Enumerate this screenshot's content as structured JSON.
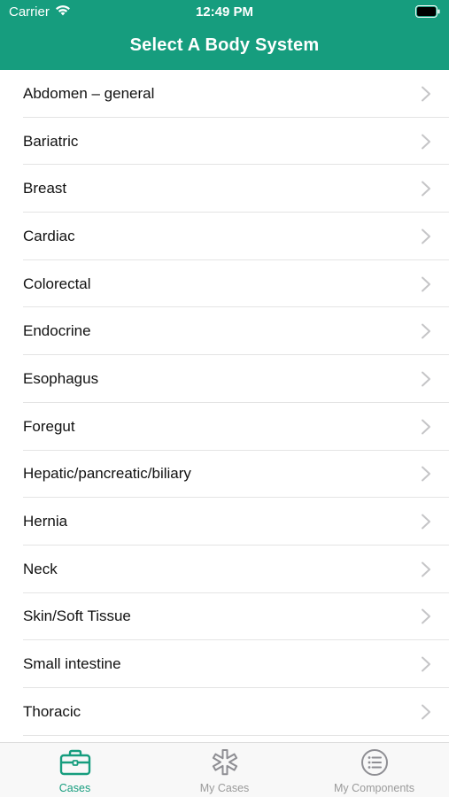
{
  "status_bar": {
    "carrier": "Carrier",
    "time": "12:49 PM"
  },
  "header": {
    "title": "Select A Body System",
    "color": "#169d7e"
  },
  "list": {
    "items": [
      {
        "label": "Abdomen – general"
      },
      {
        "label": "Bariatric"
      },
      {
        "label": "Breast"
      },
      {
        "label": "Cardiac"
      },
      {
        "label": "Colorectal"
      },
      {
        "label": "Endocrine"
      },
      {
        "label": "Esophagus"
      },
      {
        "label": "Foregut"
      },
      {
        "label": "Hepatic/pancreatic/biliary"
      },
      {
        "label": "Hernia"
      },
      {
        "label": "Neck"
      },
      {
        "label": "Skin/Soft Tissue"
      },
      {
        "label": "Small intestine"
      },
      {
        "label": "Thoracic"
      }
    ]
  },
  "tabbar": {
    "tabs": [
      {
        "label": "Cases",
        "icon": "briefcase-icon",
        "active": true
      },
      {
        "label": "My Cases",
        "icon": "asterisk-icon",
        "active": false
      },
      {
        "label": "My Components",
        "icon": "list-icon",
        "active": false
      }
    ]
  }
}
